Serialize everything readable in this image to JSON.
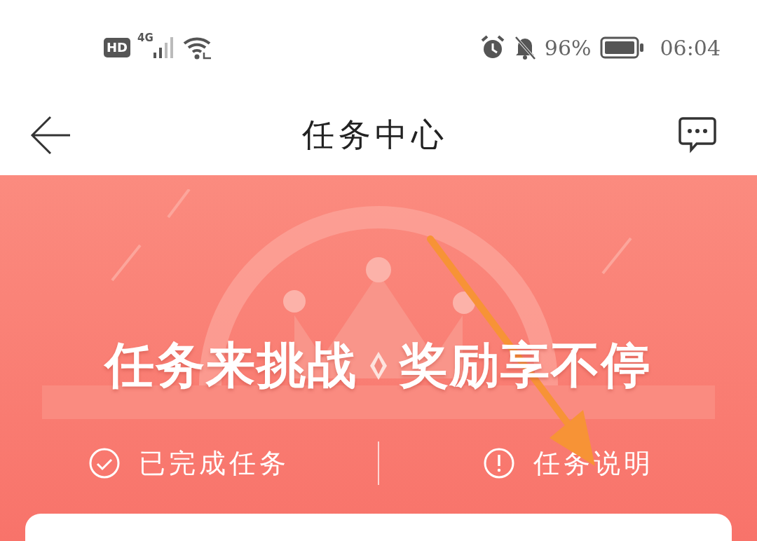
{
  "status_bar": {
    "hd_badge": "HD",
    "network_type": "4G",
    "battery": "96%",
    "time": "06:04"
  },
  "header": {
    "title": "任务中心"
  },
  "banner": {
    "headline": [
      "任务来挑战",
      "奖励享不停"
    ],
    "actions": [
      {
        "label": "已完成任务",
        "kind": "done"
      },
      {
        "label": "任务说明",
        "kind": "info"
      }
    ]
  },
  "annotation": {
    "kind": "arrow"
  }
}
